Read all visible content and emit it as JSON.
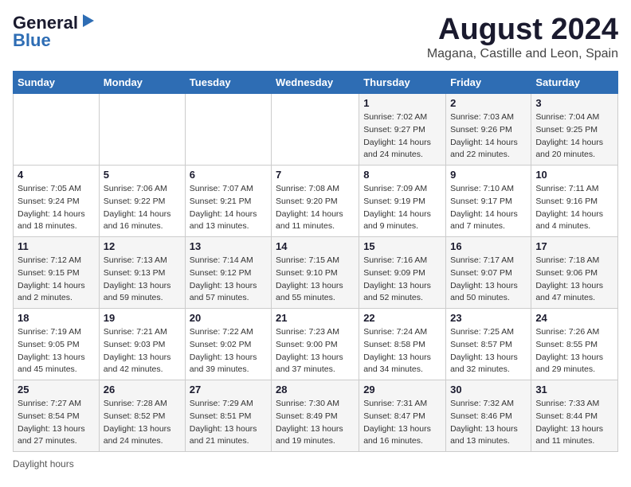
{
  "logo": {
    "line1": "General",
    "line2": "Blue"
  },
  "title": "August 2024",
  "subtitle": "Magana, Castille and Leon, Spain",
  "days_of_week": [
    "Sunday",
    "Monday",
    "Tuesday",
    "Wednesday",
    "Thursday",
    "Friday",
    "Saturday"
  ],
  "footer": "Daylight hours",
  "weeks": [
    [
      {
        "day": "",
        "sunrise": "",
        "sunset": "",
        "daylight": ""
      },
      {
        "day": "",
        "sunrise": "",
        "sunset": "",
        "daylight": ""
      },
      {
        "day": "",
        "sunrise": "",
        "sunset": "",
        "daylight": ""
      },
      {
        "day": "",
        "sunrise": "",
        "sunset": "",
        "daylight": ""
      },
      {
        "day": "1",
        "sunrise": "Sunrise: 7:02 AM",
        "sunset": "Sunset: 9:27 PM",
        "daylight": "Daylight: 14 hours and 24 minutes."
      },
      {
        "day": "2",
        "sunrise": "Sunrise: 7:03 AM",
        "sunset": "Sunset: 9:26 PM",
        "daylight": "Daylight: 14 hours and 22 minutes."
      },
      {
        "day": "3",
        "sunrise": "Sunrise: 7:04 AM",
        "sunset": "Sunset: 9:25 PM",
        "daylight": "Daylight: 14 hours and 20 minutes."
      }
    ],
    [
      {
        "day": "4",
        "sunrise": "Sunrise: 7:05 AM",
        "sunset": "Sunset: 9:24 PM",
        "daylight": "Daylight: 14 hours and 18 minutes."
      },
      {
        "day": "5",
        "sunrise": "Sunrise: 7:06 AM",
        "sunset": "Sunset: 9:22 PM",
        "daylight": "Daylight: 14 hours and 16 minutes."
      },
      {
        "day": "6",
        "sunrise": "Sunrise: 7:07 AM",
        "sunset": "Sunset: 9:21 PM",
        "daylight": "Daylight: 14 hours and 13 minutes."
      },
      {
        "day": "7",
        "sunrise": "Sunrise: 7:08 AM",
        "sunset": "Sunset: 9:20 PM",
        "daylight": "Daylight: 14 hours and 11 minutes."
      },
      {
        "day": "8",
        "sunrise": "Sunrise: 7:09 AM",
        "sunset": "Sunset: 9:19 PM",
        "daylight": "Daylight: 14 hours and 9 minutes."
      },
      {
        "day": "9",
        "sunrise": "Sunrise: 7:10 AM",
        "sunset": "Sunset: 9:17 PM",
        "daylight": "Daylight: 14 hours and 7 minutes."
      },
      {
        "day": "10",
        "sunrise": "Sunrise: 7:11 AM",
        "sunset": "Sunset: 9:16 PM",
        "daylight": "Daylight: 14 hours and 4 minutes."
      }
    ],
    [
      {
        "day": "11",
        "sunrise": "Sunrise: 7:12 AM",
        "sunset": "Sunset: 9:15 PM",
        "daylight": "Daylight: 14 hours and 2 minutes."
      },
      {
        "day": "12",
        "sunrise": "Sunrise: 7:13 AM",
        "sunset": "Sunset: 9:13 PM",
        "daylight": "Daylight: 13 hours and 59 minutes."
      },
      {
        "day": "13",
        "sunrise": "Sunrise: 7:14 AM",
        "sunset": "Sunset: 9:12 PM",
        "daylight": "Daylight: 13 hours and 57 minutes."
      },
      {
        "day": "14",
        "sunrise": "Sunrise: 7:15 AM",
        "sunset": "Sunset: 9:10 PM",
        "daylight": "Daylight: 13 hours and 55 minutes."
      },
      {
        "day": "15",
        "sunrise": "Sunrise: 7:16 AM",
        "sunset": "Sunset: 9:09 PM",
        "daylight": "Daylight: 13 hours and 52 minutes."
      },
      {
        "day": "16",
        "sunrise": "Sunrise: 7:17 AM",
        "sunset": "Sunset: 9:07 PM",
        "daylight": "Daylight: 13 hours and 50 minutes."
      },
      {
        "day": "17",
        "sunrise": "Sunrise: 7:18 AM",
        "sunset": "Sunset: 9:06 PM",
        "daylight": "Daylight: 13 hours and 47 minutes."
      }
    ],
    [
      {
        "day": "18",
        "sunrise": "Sunrise: 7:19 AM",
        "sunset": "Sunset: 9:05 PM",
        "daylight": "Daylight: 13 hours and 45 minutes."
      },
      {
        "day": "19",
        "sunrise": "Sunrise: 7:21 AM",
        "sunset": "Sunset: 9:03 PM",
        "daylight": "Daylight: 13 hours and 42 minutes."
      },
      {
        "day": "20",
        "sunrise": "Sunrise: 7:22 AM",
        "sunset": "Sunset: 9:02 PM",
        "daylight": "Daylight: 13 hours and 39 minutes."
      },
      {
        "day": "21",
        "sunrise": "Sunrise: 7:23 AM",
        "sunset": "Sunset: 9:00 PM",
        "daylight": "Daylight: 13 hours and 37 minutes."
      },
      {
        "day": "22",
        "sunrise": "Sunrise: 7:24 AM",
        "sunset": "Sunset: 8:58 PM",
        "daylight": "Daylight: 13 hours and 34 minutes."
      },
      {
        "day": "23",
        "sunrise": "Sunrise: 7:25 AM",
        "sunset": "Sunset: 8:57 PM",
        "daylight": "Daylight: 13 hours and 32 minutes."
      },
      {
        "day": "24",
        "sunrise": "Sunrise: 7:26 AM",
        "sunset": "Sunset: 8:55 PM",
        "daylight": "Daylight: 13 hours and 29 minutes."
      }
    ],
    [
      {
        "day": "25",
        "sunrise": "Sunrise: 7:27 AM",
        "sunset": "Sunset: 8:54 PM",
        "daylight": "Daylight: 13 hours and 27 minutes."
      },
      {
        "day": "26",
        "sunrise": "Sunrise: 7:28 AM",
        "sunset": "Sunset: 8:52 PM",
        "daylight": "Daylight: 13 hours and 24 minutes."
      },
      {
        "day": "27",
        "sunrise": "Sunrise: 7:29 AM",
        "sunset": "Sunset: 8:51 PM",
        "daylight": "Daylight: 13 hours and 21 minutes."
      },
      {
        "day": "28",
        "sunrise": "Sunrise: 7:30 AM",
        "sunset": "Sunset: 8:49 PM",
        "daylight": "Daylight: 13 hours and 19 minutes."
      },
      {
        "day": "29",
        "sunrise": "Sunrise: 7:31 AM",
        "sunset": "Sunset: 8:47 PM",
        "daylight": "Daylight: 13 hours and 16 minutes."
      },
      {
        "day": "30",
        "sunrise": "Sunrise: 7:32 AM",
        "sunset": "Sunset: 8:46 PM",
        "daylight": "Daylight: 13 hours and 13 minutes."
      },
      {
        "day": "31",
        "sunrise": "Sunrise: 7:33 AM",
        "sunset": "Sunset: 8:44 PM",
        "daylight": "Daylight: 13 hours and 11 minutes."
      }
    ]
  ]
}
